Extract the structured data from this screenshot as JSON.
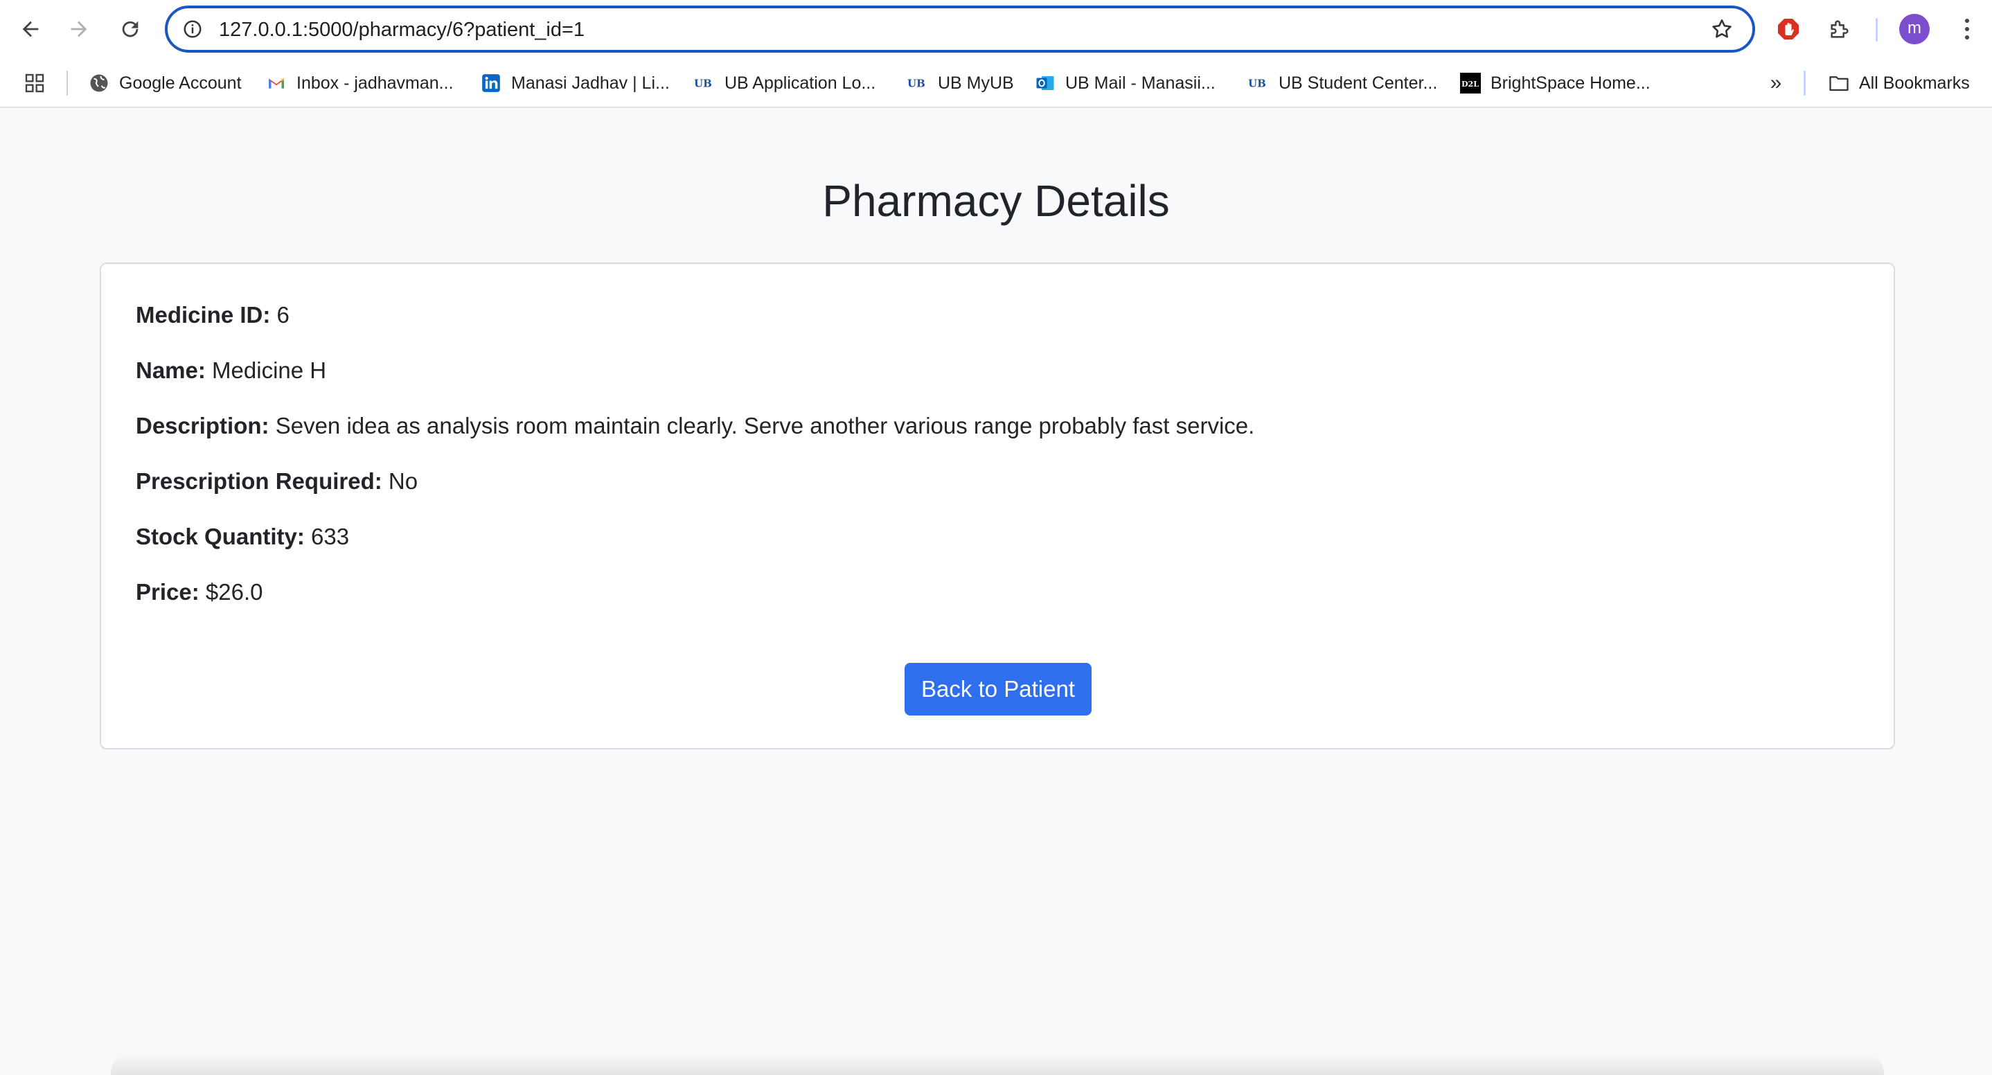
{
  "browser": {
    "url_host": "127.0.0.1",
    "url_rest": ":5000/pharmacy/6?patient_id=1",
    "profile_initial": "m"
  },
  "bookmarks": {
    "items": [
      {
        "label": "Google Account",
        "icon": "globe-icon"
      },
      {
        "label": "Inbox - jadhavman...",
        "icon": "gmail-icon"
      },
      {
        "label": "Manasi Jadhav | Li...",
        "icon": "linkedin-icon"
      },
      {
        "label": "UB Application Lo...",
        "icon": "ub-icon"
      },
      {
        "label": "UB MyUB",
        "icon": "ub-icon"
      },
      {
        "label": "UB Mail - Manasii...",
        "icon": "outlook-icon"
      },
      {
        "label": "UB Student Center...",
        "icon": "ub-icon"
      },
      {
        "label": "BrightSpace Home...",
        "icon": "d2l-icon"
      }
    ],
    "more": "»",
    "all_bookmarks": "All Bookmarks"
  },
  "page": {
    "title": "Pharmacy Details",
    "fields": [
      {
        "label": "Medicine ID:",
        "value": "6"
      },
      {
        "label": "Name:",
        "value": "Medicine H"
      },
      {
        "label": "Description:",
        "value": "Seven idea as analysis room maintain clearly. Serve another various range probably fast service."
      },
      {
        "label": "Prescription Required:",
        "value": "No"
      },
      {
        "label": "Stock Quantity:",
        "value": "633"
      },
      {
        "label": "Price:",
        "value": "$26.0"
      }
    ],
    "back_button": "Back to Patient"
  },
  "colors": {
    "accent": "#2f6fed",
    "omnibox_border": "#1a56c4",
    "page_bg": "#f8f9fa"
  }
}
